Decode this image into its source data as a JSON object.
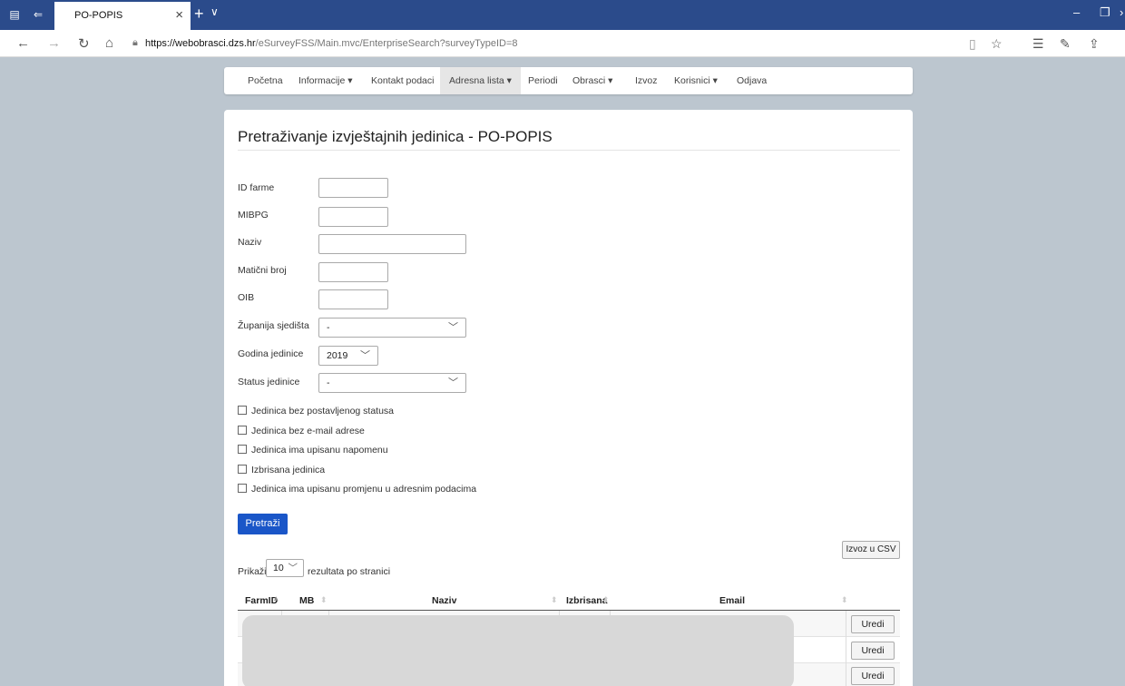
{
  "browser": {
    "tab_title": "PO-POPIS",
    "tab_close": "×",
    "new_tab": "+",
    "tab_dropdown": "∨",
    "url_host": "https://webobrasci.dzs.hr",
    "url_path": "/eSurveyFSS/Main.mvc/EnterpriseSearch?surveyTypeID=8",
    "icons": [
      "back-icon",
      "forward-icon",
      "refresh-icon",
      "home-icon",
      "lock-icon",
      "reading-view-icon",
      "favorite-star-icon",
      "favorites-list-icon",
      "pen-icon",
      "share-icon"
    ]
  },
  "nav": {
    "items": [
      {
        "label": "Početna"
      },
      {
        "label": "Informacije ▾"
      },
      {
        "label": "Kontakt podaci"
      },
      {
        "label": "Adresna lista ▾"
      },
      {
        "label": "Periodi"
      },
      {
        "label": "Obrasci ▾"
      },
      {
        "label": "Izvoz"
      },
      {
        "label": "Korisnici ▾"
      },
      {
        "label": "Odjava"
      }
    ],
    "active": "Adresna lista"
  },
  "page": {
    "title": "Pretraživanje izvještajnih jedinica - PO-POPIS"
  },
  "form": {
    "id_farme_label": "ID farme",
    "mibpg_label": "MIBPG",
    "naziv_label": "Naziv",
    "maticni_label": "Matični broj",
    "oib_label": "OIB",
    "zupanija_label": "Županija sjedišta",
    "zupanija_value": "-",
    "godina_label": "Godina jedinice",
    "godina_value": "2019",
    "status_label": "Status jedinice",
    "status_value": "-",
    "checkboxes": [
      {
        "label": "Jedinica bez postavljenog statusa"
      },
      {
        "label": "Jedinica bez e-mail adrese"
      },
      {
        "label": "Jedinica ima upisanu napomenu"
      },
      {
        "label": "Izbrisana jedinica"
      },
      {
        "label": "Jedinica ima upisanu promjenu u adresnim podacima"
      }
    ],
    "search_button": "Pretraži"
  },
  "results": {
    "export_button": "Izvoz u CSV",
    "show_label": "Prikaži",
    "page_size": "10",
    "per_page_label": "rezultata po stranici",
    "columns": [
      {
        "label": "FarmID"
      },
      {
        "label": "MB"
      },
      {
        "label": "Naziv"
      },
      {
        "label": "Izbrisana"
      },
      {
        "label": "Email"
      }
    ],
    "edit_label": "Uredi"
  }
}
